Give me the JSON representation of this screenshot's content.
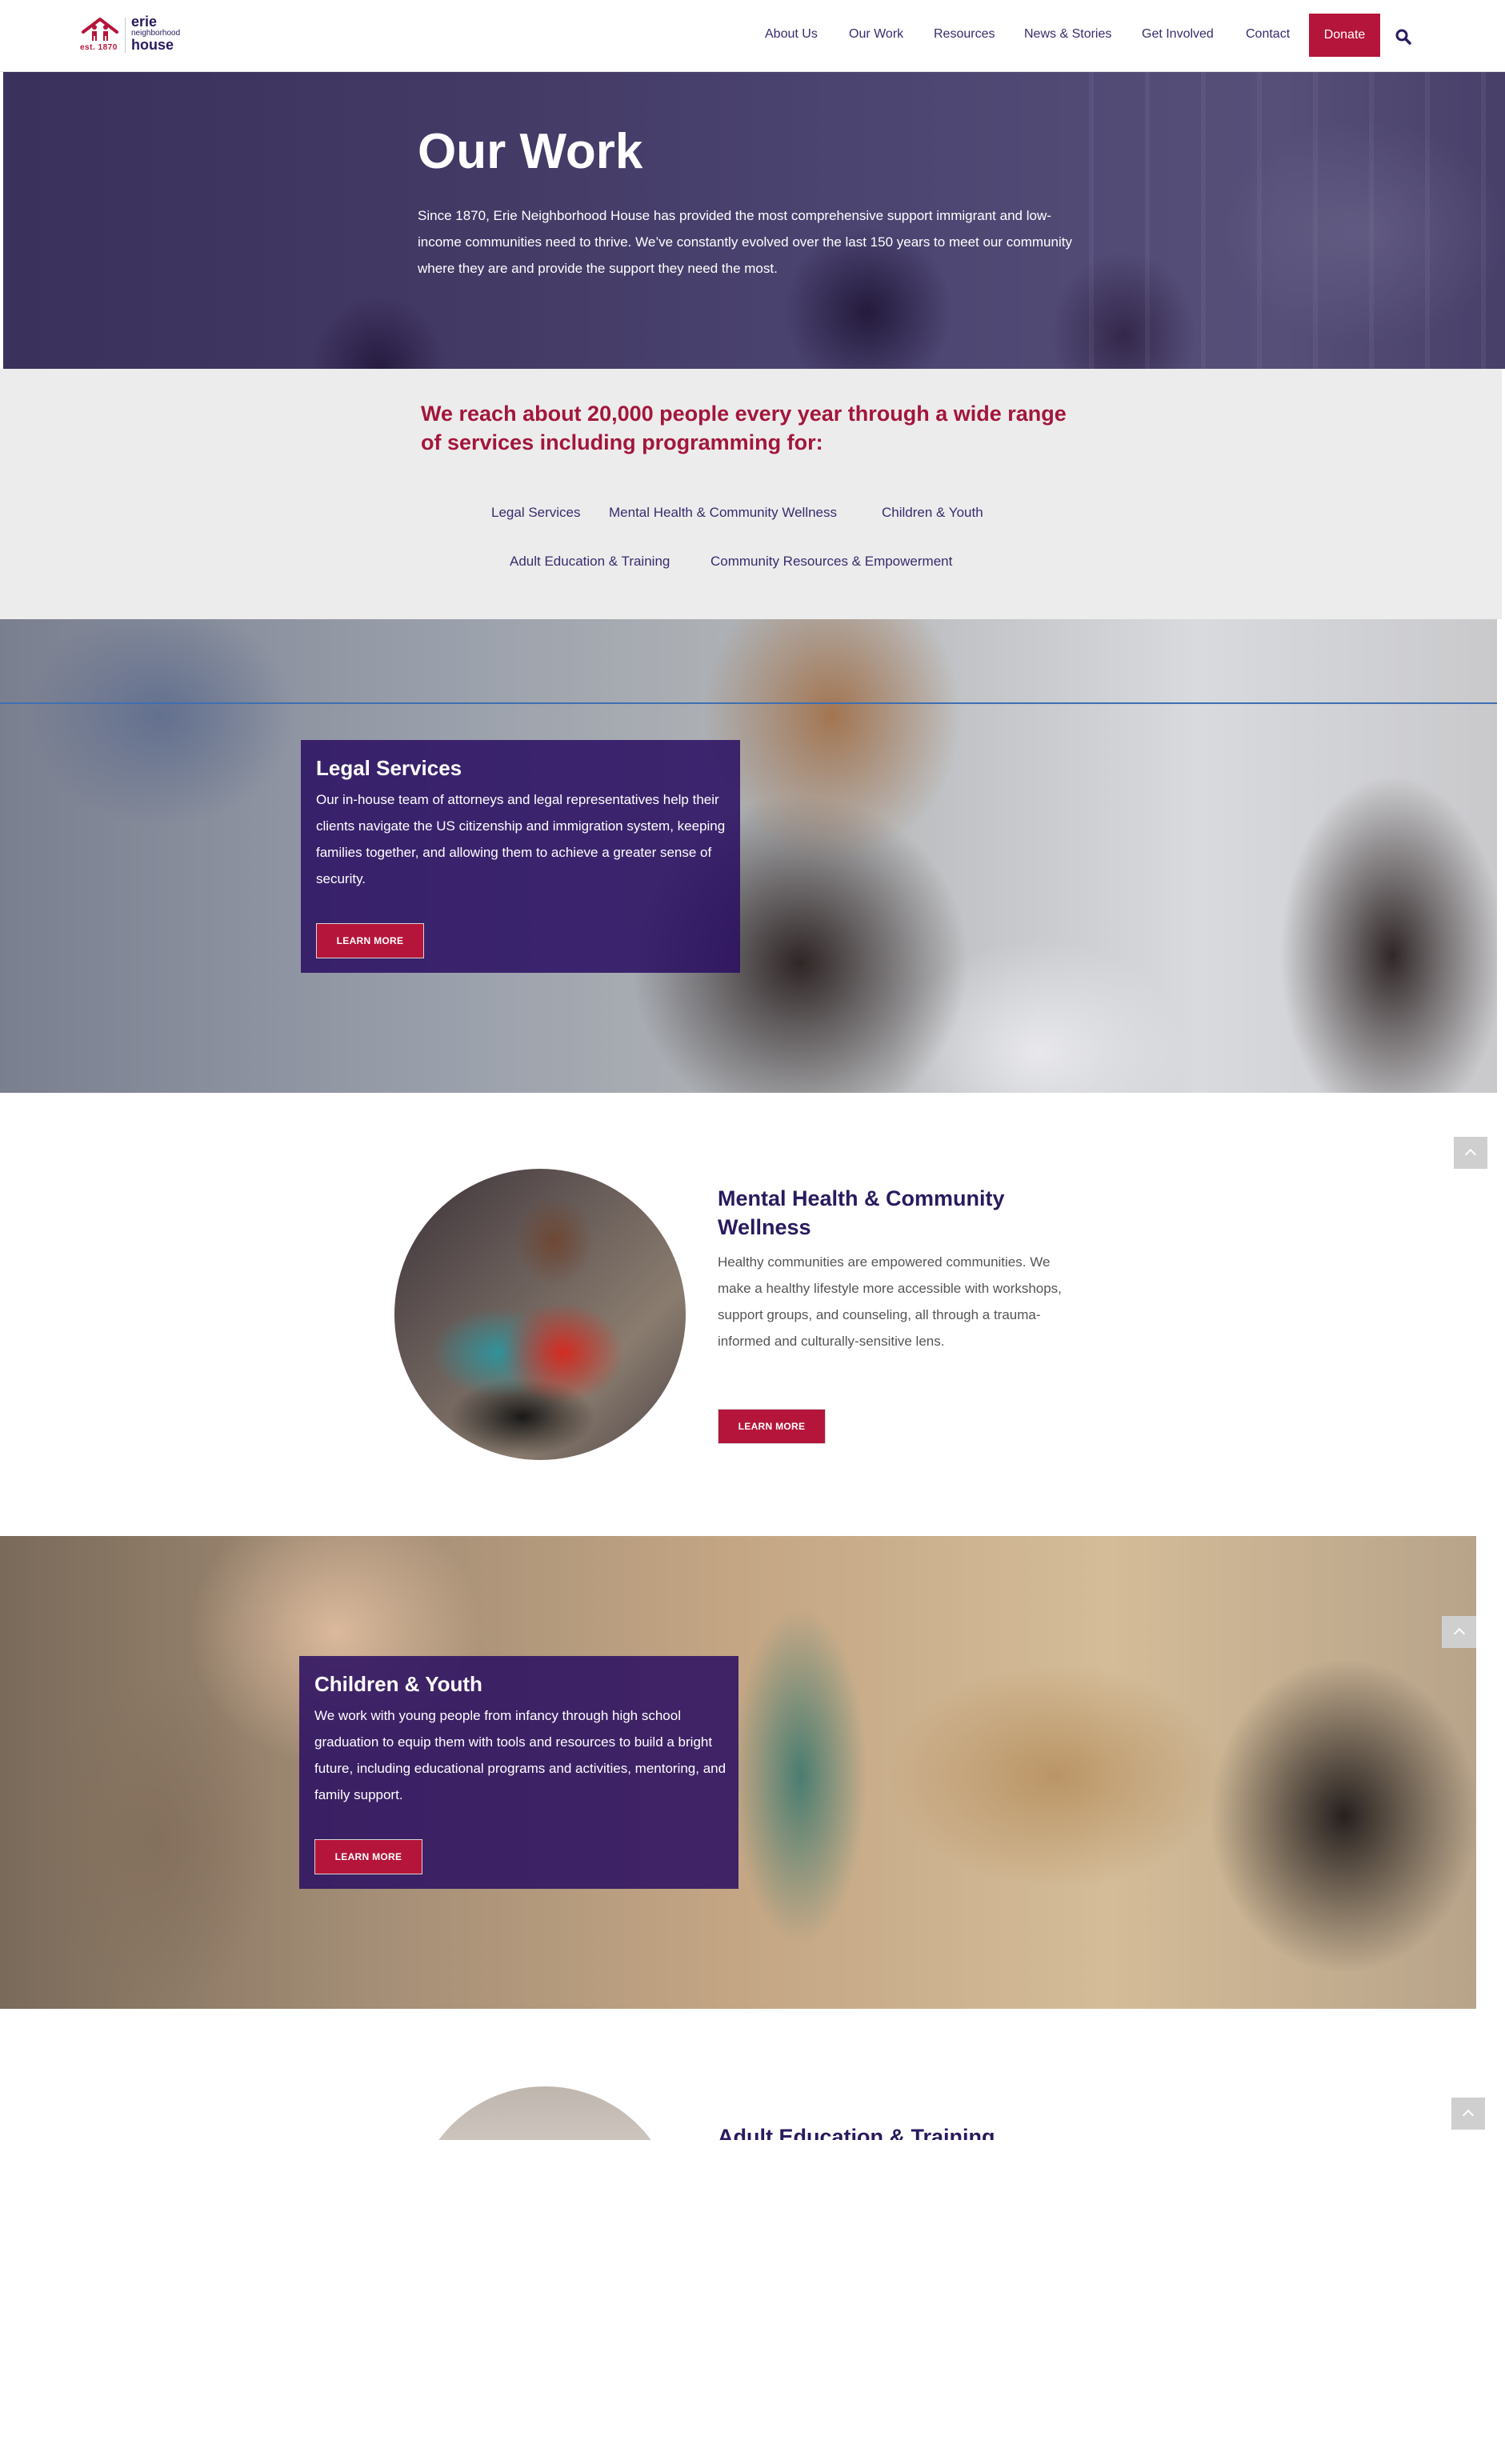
{
  "header": {
    "logo": {
      "est": "est. 1870",
      "line1": "erie",
      "line2": "neighborhood",
      "line3": "house"
    },
    "nav": [
      "About Us",
      "Our Work",
      "Resources",
      "News & Stories",
      "Get Involved",
      "Contact"
    ],
    "donate_label": "Donate",
    "brand_color": "#b5153a",
    "nav_color": "#3a2b6e"
  },
  "hero": {
    "title": "Our Work",
    "text": "Since 1870, Erie Neighborhood House has provided the most comprehensive support immigrant and low-income communities need to thrive. We’ve constantly evolved over the last 150 years to meet our community where they are and provide the support they need the most."
  },
  "intro": {
    "heading": "We reach about 20,000 people every year through a wide range of services including programming for:",
    "links": [
      "Legal Services",
      "Mental Health & Community Wellness",
      "Children & Youth",
      "Adult Education & Training",
      "Community Resources & Empowerment"
    ]
  },
  "sections": {
    "legal": {
      "title": "Legal Services",
      "text": "Our in-house team of attorneys and legal representatives help their clients navigate the US citizenship and immigration system, keeping families together, and allowing them to achieve a greater sense of security.",
      "button": "LEARN MORE"
    },
    "mental_health": {
      "title": "Mental Health & Community Wellness",
      "text": "Healthy communities are empowered communities. We make a healthy lifestyle more accessible with workshops, support groups, and counseling, all through a trauma-informed and culturally-sensitive lens.",
      "button": "LEARN MORE"
    },
    "children": {
      "title": "Children & Youth",
      "text": "We work with young people from infancy through high school graduation to equip them with tools and resources to build a bright future, including educational programs and activities, mentoring, and family support.",
      "button": "LEARN MORE"
    },
    "adult_ed": {
      "title": "Adult Education & Training"
    }
  },
  "icons": {
    "logo": "house-people-icon",
    "search": "search-icon",
    "scroll_top": "chevron-up-icon"
  }
}
